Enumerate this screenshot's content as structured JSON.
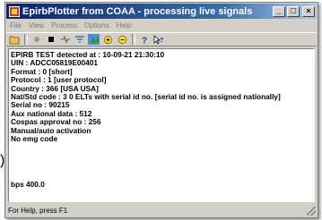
{
  "outside_text": ")",
  "window": {
    "title": "EpirbPlotter from COAA - processing live signals",
    "minimize_label": "_",
    "maximize_label": "□",
    "close_label": "×"
  },
  "menu": [
    "File",
    "View",
    "Process",
    "Options",
    "Help"
  ],
  "toolbar": [
    "open-icon",
    "record-icon",
    "stop-icon",
    "signal-icon",
    "filter-icon",
    "map-icon",
    "zoom-in-icon",
    "zoom-out-icon",
    "help-icon",
    "context-help-icon"
  ],
  "content": {
    "lines": [
      "EPIRB TEST detected at : 10-09-21 21:30:10",
      "UIN   : ADCC05819E00401",
      "  Format  : 0 [short]",
      "  Protocol : 1 [user protocol]",
      "  Country : 366 [USA USA]",
      "  Nat/Std code : 3 0 ELTs with serial id no. [serial id no. is assigned nationally]",
      "Serial no : 90215",
      "Aux national data : 512",
      "Cospas approval no : 256",
      "Manual/auto activation",
      "No emg code"
    ],
    "bps": "bps 400.0"
  },
  "status": {
    "text": "For Help, press F1"
  },
  "colors": {
    "titlebar_start": "#0a246a",
    "titlebar_end": "#a6caf0",
    "chrome": "#d4d0c8"
  }
}
